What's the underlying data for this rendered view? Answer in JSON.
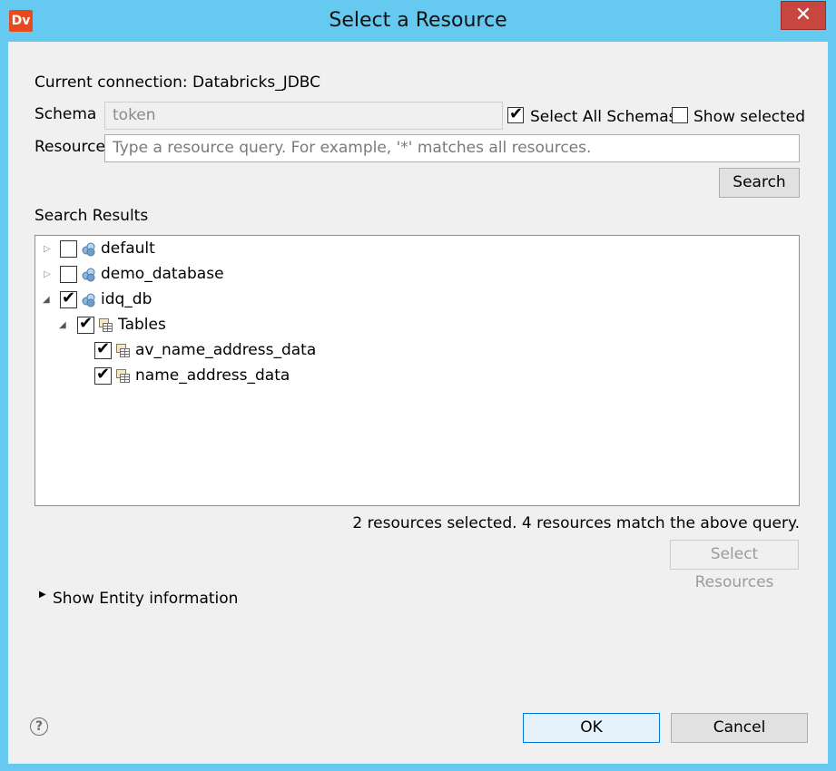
{
  "window": {
    "app_icon_text": "Dv",
    "title": "Select a Resource",
    "close_glyph": "✕"
  },
  "connection": {
    "label": "Current connection: Databricks_JDBC"
  },
  "schema": {
    "label": "Schema",
    "value": "token",
    "select_all_label": "Select All Schemas",
    "select_all_checked": true,
    "show_selected_label": "Show selected",
    "show_selected_checked": false
  },
  "resource": {
    "label": "Resource",
    "placeholder": "Type a resource query. For example, '*' matches all resources."
  },
  "search_button": "Search",
  "results": {
    "label": "Search Results",
    "tree": [
      {
        "label": "default",
        "checked": false,
        "expanded": false,
        "icon": "database-icon"
      },
      {
        "label": "demo_database",
        "checked": false,
        "expanded": false,
        "icon": "database-icon"
      },
      {
        "label": "idq_db",
        "checked": true,
        "expanded": true,
        "icon": "database-icon"
      },
      {
        "label": "Tables",
        "checked": true,
        "expanded": true,
        "icon": "table-folder-icon"
      },
      {
        "label": "av_name_address_data",
        "checked": true,
        "icon": "table-icon"
      },
      {
        "label": "name_address_data",
        "checked": true,
        "icon": "table-icon"
      }
    ],
    "status": "2 resources selected. 4 resources match the above query."
  },
  "select_resources_button": "Select Resources",
  "entity_info_label": "Show Entity information",
  "help_glyph": "?",
  "ok_button": "OK",
  "cancel_button": "Cancel"
}
